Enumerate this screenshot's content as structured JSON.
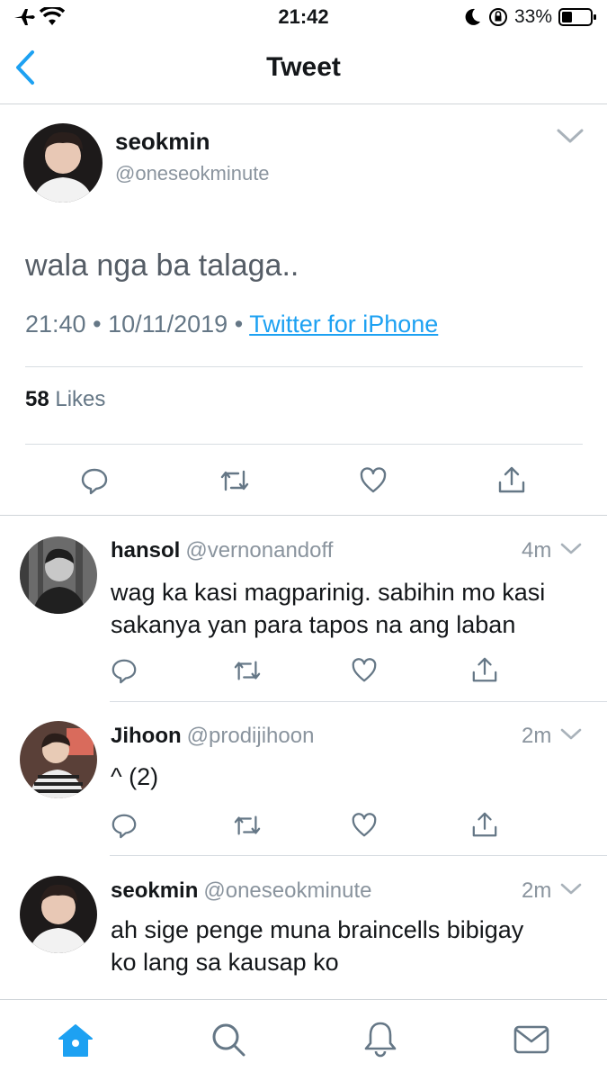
{
  "status_bar": {
    "time": "21:42",
    "battery": "33%"
  },
  "nav": {
    "title": "Tweet"
  },
  "main_tweet": {
    "name": "seokmin",
    "handle": "@oneseokminute",
    "text": "wala nga ba talaga..",
    "time": "21:40",
    "date": "10/11/2019",
    "source": "Twitter for iPhone",
    "likes_count": "58",
    "likes_label": "Likes"
  },
  "replies": [
    {
      "name": "hansol",
      "handle": "@vernonandoff",
      "time": "4m",
      "text_lines": [
        "wag ka kasi magparinig. sabihin mo kasi",
        "sakanya yan para tapos na ang laban"
      ]
    },
    {
      "name": "Jihoon",
      "handle": "@prodijihoon",
      "time": "2m",
      "text_lines": [
        "^ (2)"
      ]
    },
    {
      "name": "seokmin",
      "handle": "@oneseokminute",
      "time": "2m",
      "text_lines": [
        "ah sige penge muna braincells bibigay",
        "ko lang sa kausap ko"
      ]
    }
  ],
  "colors": {
    "accent": "#1da1f2",
    "text": "#14171a",
    "secondary": "#657786"
  },
  "icons": {
    "status": [
      "airplane-icon",
      "wifi-icon",
      "moon-icon",
      "orientation-lock-icon",
      "battery-icon"
    ],
    "actions": [
      "reply-icon",
      "retweet-icon",
      "like-icon",
      "share-icon"
    ],
    "tabs": [
      "home-icon",
      "search-icon",
      "notifications-icon",
      "messages-icon"
    ]
  }
}
